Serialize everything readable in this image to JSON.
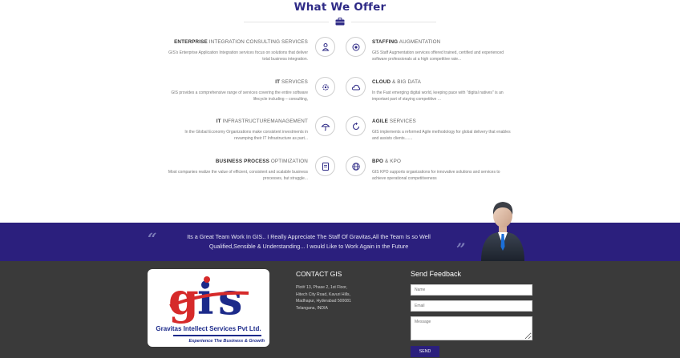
{
  "section_title": "What We Offer",
  "services_left": [
    {
      "title_bold": "ENTERPRISE",
      "title_rest": " INTEGRATION CONSULTING SERVICES",
      "desc_1": "GIS's Enterprise Application Integration services focus on solutions that deliver",
      "desc_2": "total business integration.",
      "icon": "people-icon"
    },
    {
      "title_bold": "IT",
      "title_rest": " SERVICES",
      "desc_1": "GIS provides a comprehensive range of services covering the entire software",
      "desc_2": "lifecycle including – consulting,",
      "icon": "gear-icon"
    },
    {
      "title_bold": "IT",
      "title_rest": " INFRASTRUCTUREMANAGEMENT",
      "desc_1": "In the Global Economy Organizations make consistent investments in",
      "desc_2": "revamping their IT Infrastructure as part...",
      "icon": "umbrella-icon"
    },
    {
      "title_bold": "BUSINESS PROCESS",
      "title_rest": " OPTIMIZATION",
      "desc_1": "Most companies realize the value of efficient, consistent and scalable business",
      "desc_2": "processes, but struggle...",
      "icon": "document-icon"
    }
  ],
  "services_right": [
    {
      "title_bold": "STAFFING",
      "title_rest": " AUGMENTATION",
      "desc_1": "GIS Staff Augmentation services offered trained, certified and experienced",
      "desc_2": "software professionals at a high competitive rate...",
      "icon": "target-icon"
    },
    {
      "title_bold": "CLOUD",
      "title_rest": " & BIG DATA",
      "desc_1": "In the Fast emerging digital world, keeping pace with \"digital natives\" is an",
      "desc_2": "important part of staying competitive ...",
      "icon": "cloud-icon"
    },
    {
      "title_bold": "AGILE",
      "title_rest": " SERVICES",
      "desc_1": "GIS implements a reformed Agile methodology for global delivery that enables",
      "desc_2": "and assists clients.......",
      "icon": "cycle-icon"
    },
    {
      "title_bold": "BPO",
      "title_rest": " & KPO",
      "desc_1": "GIS KPO supports organizations for innovative solutions and services to",
      "desc_2": "achieve operational competitiveness",
      "icon": "globe-icon"
    }
  ],
  "testimonial": {
    "line_1": "Its a Great Team Work In GIS.. I Really Appreciate The Staff Of Gravitas,All the Team Is so Well",
    "line_2": "Qualified,Sensible & Understanding... I would Like to Work Again in the Future",
    "open_quote": "“",
    "close_quote": "”"
  },
  "logo": {
    "company": "Gravitas Intellect Services Pvt Ltd.",
    "tagline": "Experience The Business & Growth"
  },
  "contact": {
    "title": "CONTACT GIS",
    "address_lines": [
      "Plot# 13, Phase 2, 1st Floor,",
      "Hitech City Road, Kavuri Hills,",
      "Madhapur, Hyderabad 500081",
      "Telangana, INDIA"
    ]
  },
  "feedback": {
    "title": "Send Feedback",
    "name_placeholder": "Name",
    "email_placeholder": "Email",
    "message_placeholder": "Message",
    "send_label": "SEND"
  },
  "colors": {
    "brand_purple": "#2b1f7d",
    "title_blue": "#2e2a86",
    "footer_bg": "#3a3a3a"
  }
}
